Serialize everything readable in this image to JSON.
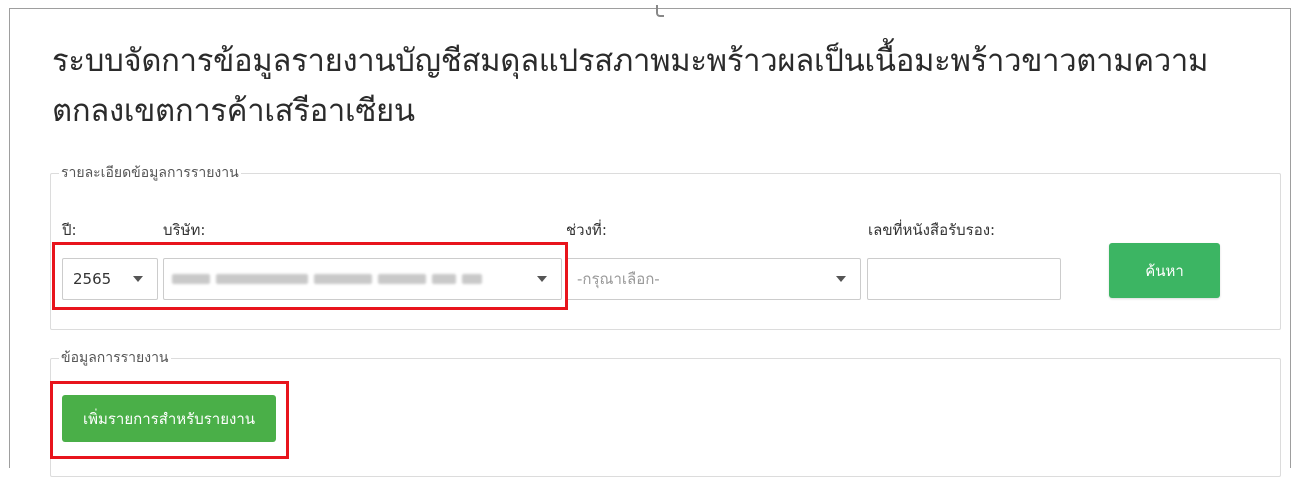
{
  "page": {
    "title": "ระบบจัดการข้อมูลรายงานบัญชีสมดุลแปรสภาพมะพร้าวผลเป็นเนื้อมะพร้าวขาวตามความตกลงเขตการค้าเสรีอาเซียน"
  },
  "report_details": {
    "legend": "รายละเอียดข้อมูลการรายงาน",
    "year_label": "ปี:",
    "year_value": "2565",
    "company_label": "บริษัท:",
    "period_label": "ช่วงที่:",
    "period_placeholder": "-กรุณาเลือก-",
    "certificate_label": "เลขที่หนังสือรับรอง:",
    "certificate_value": "",
    "search_button": "ค้นหา"
  },
  "report_info": {
    "legend": "ข้อมูลการรายงาน",
    "add_button": "เพิ่มรายการสำหรับรายงาน"
  },
  "colors": {
    "search_button": "#3cb563",
    "add_button": "#4aaf48",
    "highlight": "#e8141c"
  }
}
